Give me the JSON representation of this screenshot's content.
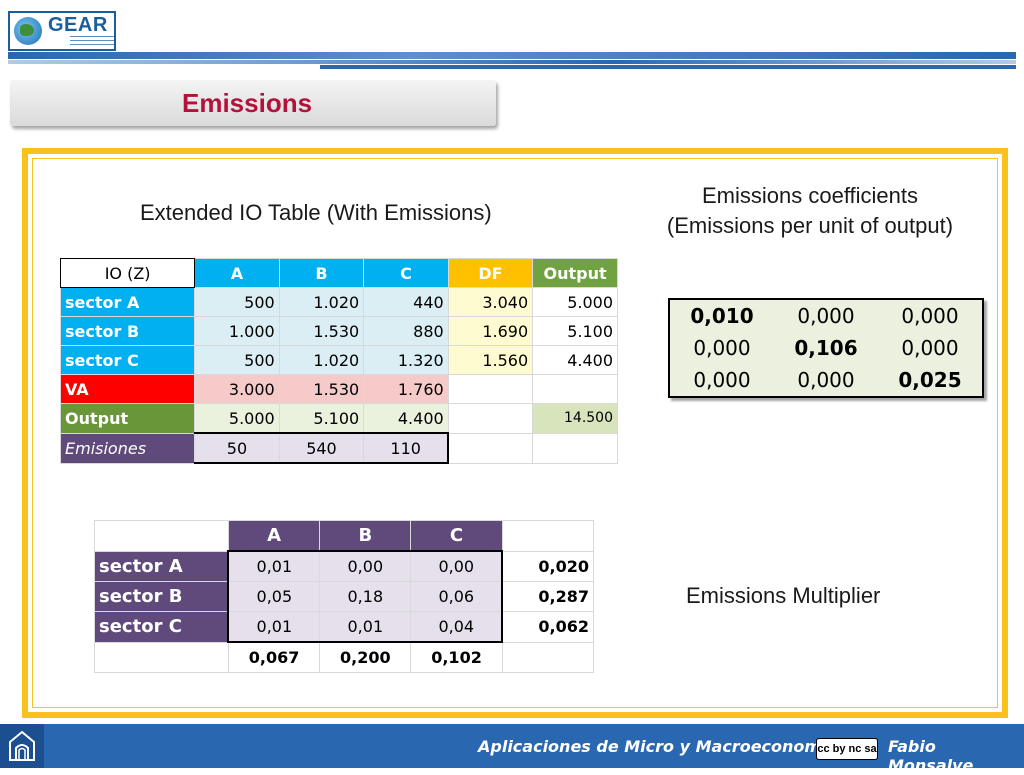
{
  "header": {
    "logo_text": "GEAR",
    "title": "Emissions"
  },
  "captions": {
    "io_table": "Extended IO Table (With Emissions)",
    "coefficients_line1": "Emissions coefficients",
    "coefficients_line2": "(Emissions per unit of output)",
    "multiplier": "Emissions Multiplier"
  },
  "io_table": {
    "headers": [
      "IO (Z)",
      "A",
      "B",
      "C",
      "DF",
      "Output"
    ],
    "rows": [
      {
        "label": "sector A",
        "values": [
          "500",
          "1.020",
          "440",
          "3.040",
          "5.000"
        ]
      },
      {
        "label": "sector B",
        "values": [
          "1.000",
          "1.530",
          "880",
          "1.690",
          "5.100"
        ]
      },
      {
        "label": "sector C",
        "values": [
          "500",
          "1.020",
          "1.320",
          "1.560",
          "4.400"
        ]
      }
    ],
    "va": {
      "label": "VA",
      "values": [
        "3.000",
        "1.530",
        "1.760"
      ]
    },
    "output": {
      "label": "Output",
      "values": [
        "5.000",
        "5.100",
        "4.400"
      ],
      "total": "14.500"
    },
    "emissions": {
      "label": "Emisiones",
      "values": [
        "50",
        "540",
        "110"
      ]
    }
  },
  "coefficients": [
    [
      "0,010",
      "0,000",
      "0,000"
    ],
    [
      "0,000",
      "0,106",
      "0,000"
    ],
    [
      "0,000",
      "0,000",
      "0,025"
    ]
  ],
  "multiplier_table": {
    "headers": [
      "A",
      "B",
      "C"
    ],
    "rows": [
      {
        "label": "sector A",
        "values": [
          "0,01",
          "0,00",
          "0,00"
        ],
        "row_total": "0,020"
      },
      {
        "label": "sector B",
        "values": [
          "0,05",
          "0,18",
          "0,06"
        ],
        "row_total": "0,287"
      },
      {
        "label": "sector C",
        "values": [
          "0,01",
          "0,01",
          "0,04"
        ],
        "row_total": "0,062"
      }
    ],
    "column_totals": [
      "0,067",
      "0,200",
      "0,102"
    ]
  },
  "footer": {
    "course": "Aplicaciones de Micro y Macroeconomía",
    "license": "cc by nc sa",
    "author": "Fabio Monsalve"
  },
  "colors": {
    "title": "#b3123d",
    "frame": "#f7c21b",
    "footer": "#2a67b1",
    "sector_blue": "#00b0f0",
    "purple": "#604a7b"
  }
}
